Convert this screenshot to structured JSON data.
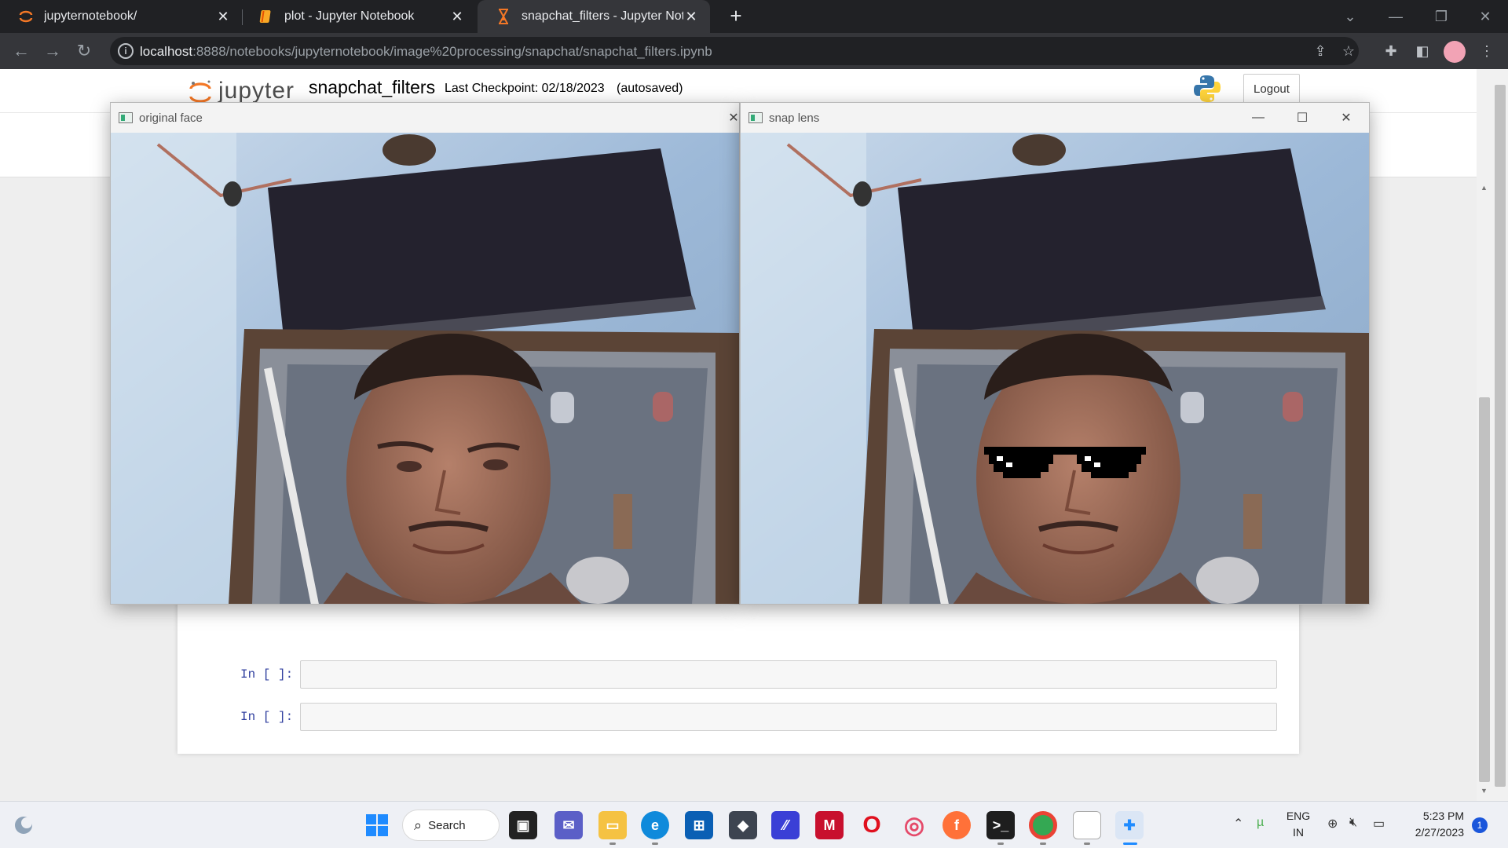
{
  "browser": {
    "tabs": [
      {
        "title": "jupyternotebook/",
        "icon": "jupyter-icon",
        "active": false
      },
      {
        "title": "plot - Jupyter Notebook",
        "icon": "notebook-icon",
        "active": false
      },
      {
        "title": "snapchat_filters - Jupyter Noteb",
        "icon": "hourglass-icon",
        "active": true
      }
    ],
    "url_host": "localhost",
    "url_rest": ":8888/notebooks/jupyternotebook/image%20processing/snapchat/snapchat_filters.ipynb"
  },
  "jupyter": {
    "logo_text": "jupyter",
    "notebook_name": "snapchat_filters",
    "checkpoint": "Last Checkpoint: 02/18/2023",
    "autosave": "(autosaved)",
    "logout_label": "Logout",
    "cells": [
      {
        "prompt": "In [ ]:",
        "value": ""
      },
      {
        "prompt": "In [ ]:",
        "value": ""
      }
    ]
  },
  "windows": [
    {
      "title": "original face",
      "filter": "none"
    },
    {
      "title": "snap lens",
      "filter": "thug-life-sunglasses"
    }
  ],
  "taskbar": {
    "search_label": "Search",
    "lang_line1": "ENG",
    "lang_line2": "IN",
    "time": "5:23 PM",
    "date": "2/27/2023",
    "notification_count": "1"
  },
  "colors": {
    "chrome_dark": "#202124",
    "chrome_toolbar": "#35363a",
    "jupyter_orange": "#f37726",
    "prompt_blue": "#303f9f"
  }
}
